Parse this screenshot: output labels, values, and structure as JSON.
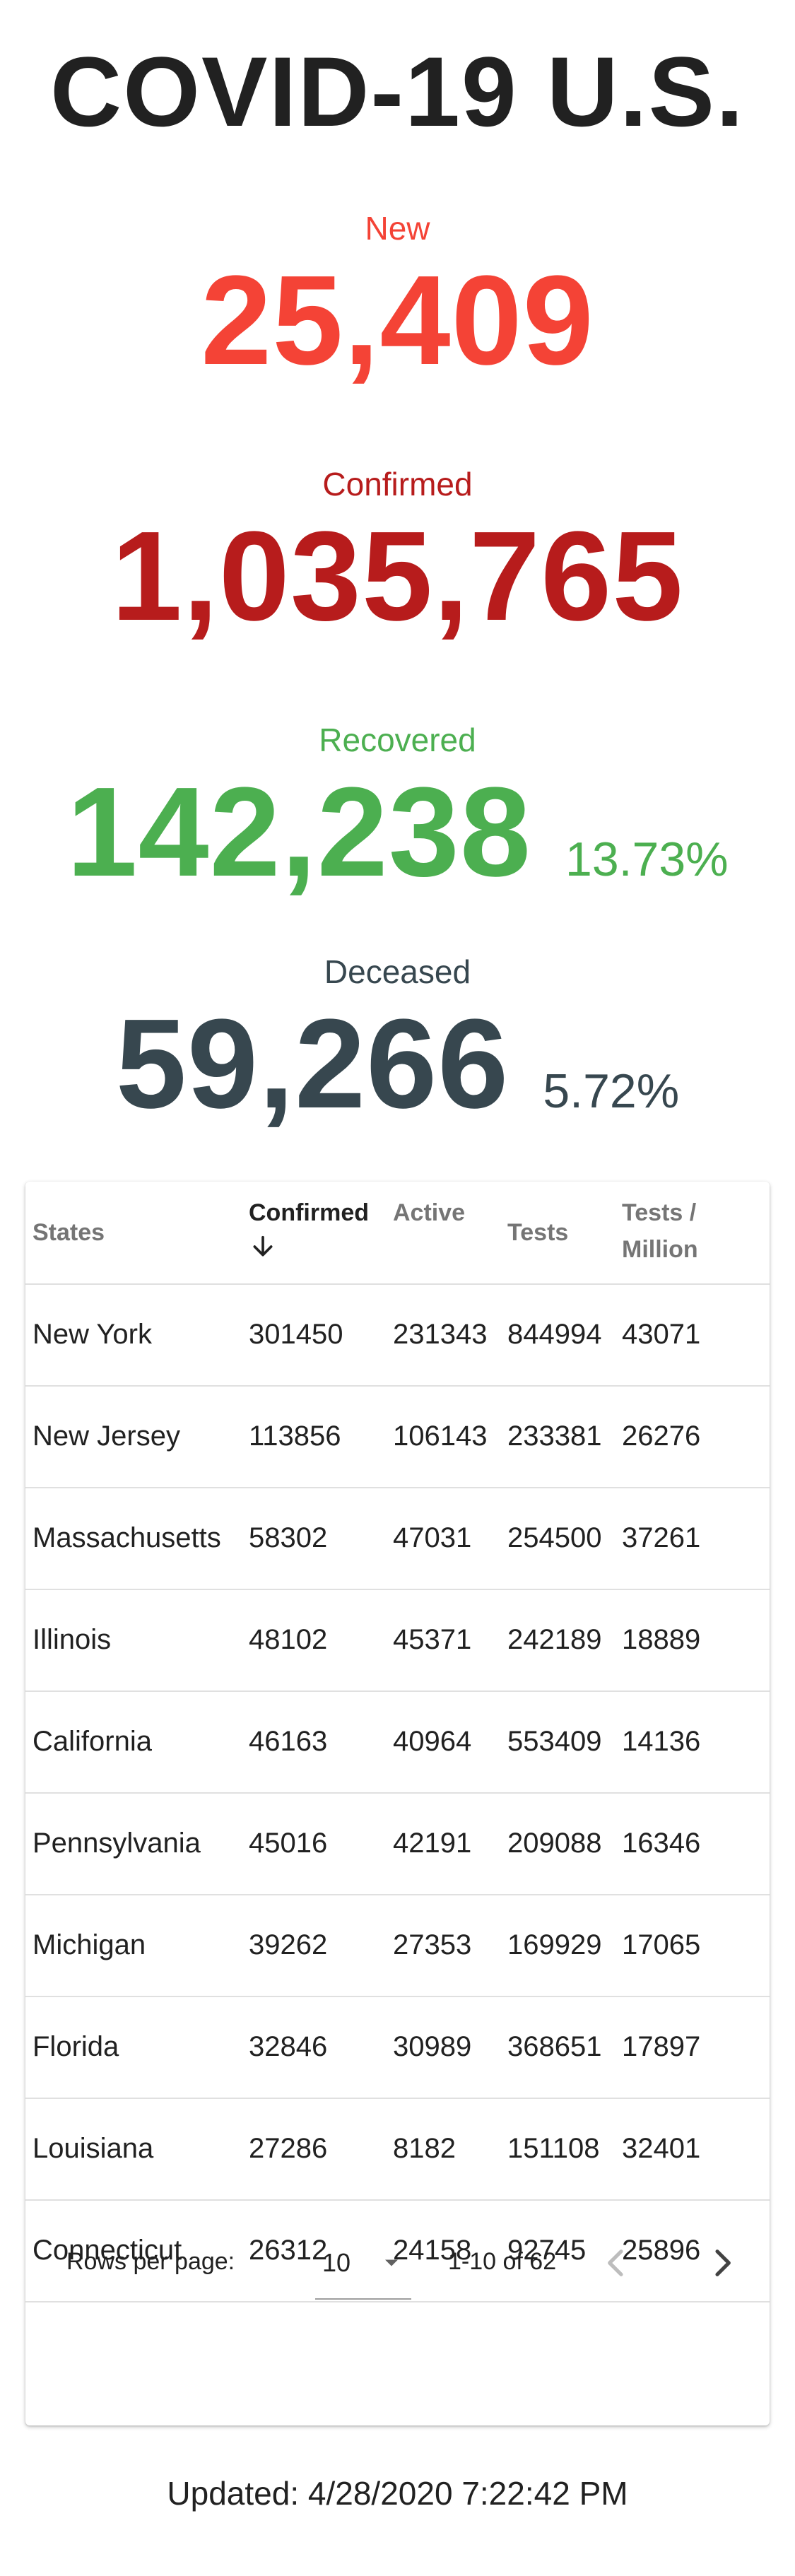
{
  "header": {
    "title": "COVID-19 U.S."
  },
  "stats": {
    "new": {
      "label": "New",
      "value": "25,409"
    },
    "confirmed": {
      "label": "Confirmed",
      "value": "1,035,765"
    },
    "recovered": {
      "label": "Recovered",
      "value": "142,238",
      "pct": "13.73%"
    },
    "deceased": {
      "label": "Deceased",
      "value": "59,266",
      "pct": "5.72%"
    }
  },
  "table": {
    "columns": [
      "States",
      "Confirmed",
      "Active",
      "Tests",
      "Tests /",
      "Million"
    ],
    "sorted_column": "Confirmed",
    "rows": [
      [
        "New York",
        "301450",
        "231343",
        "844994",
        "43071"
      ],
      [
        "New Jersey",
        "113856",
        "106143",
        "233381",
        "26276"
      ],
      [
        "Massachusetts",
        "58302",
        "47031",
        "254500",
        "37261"
      ],
      [
        "Illinois",
        "48102",
        "45371",
        "242189",
        "18889"
      ],
      [
        "California",
        "46163",
        "40964",
        "553409",
        "14136"
      ],
      [
        "Pennsylvania",
        "45016",
        "42191",
        "209088",
        "16346"
      ],
      [
        "Michigan",
        "39262",
        "27353",
        "169929",
        "17065"
      ],
      [
        "Florida",
        "32846",
        "30989",
        "368651",
        "17897"
      ],
      [
        "Louisiana",
        "27286",
        "8182",
        "151108",
        "32401"
      ],
      [
        "Connecticut",
        "26312",
        "24158",
        "92745",
        "25896"
      ]
    ],
    "pagination": {
      "rows_per_page_label": "Rows per page:",
      "rows_per_page_value": "10",
      "range_text": "1-10 of 62"
    }
  },
  "footer": {
    "updated": "Updated: 4/28/2020 7:22:42 PM"
  },
  "colors": {
    "new": "#f44336",
    "confirmed": "#b71c1c",
    "recovered": "#4caf50",
    "deceased": "#37474f"
  },
  "icons": {
    "sort": "arrow-down-icon",
    "select": "caret-down-icon",
    "prev": "chevron-left-icon",
    "next": "chevron-right-icon"
  }
}
